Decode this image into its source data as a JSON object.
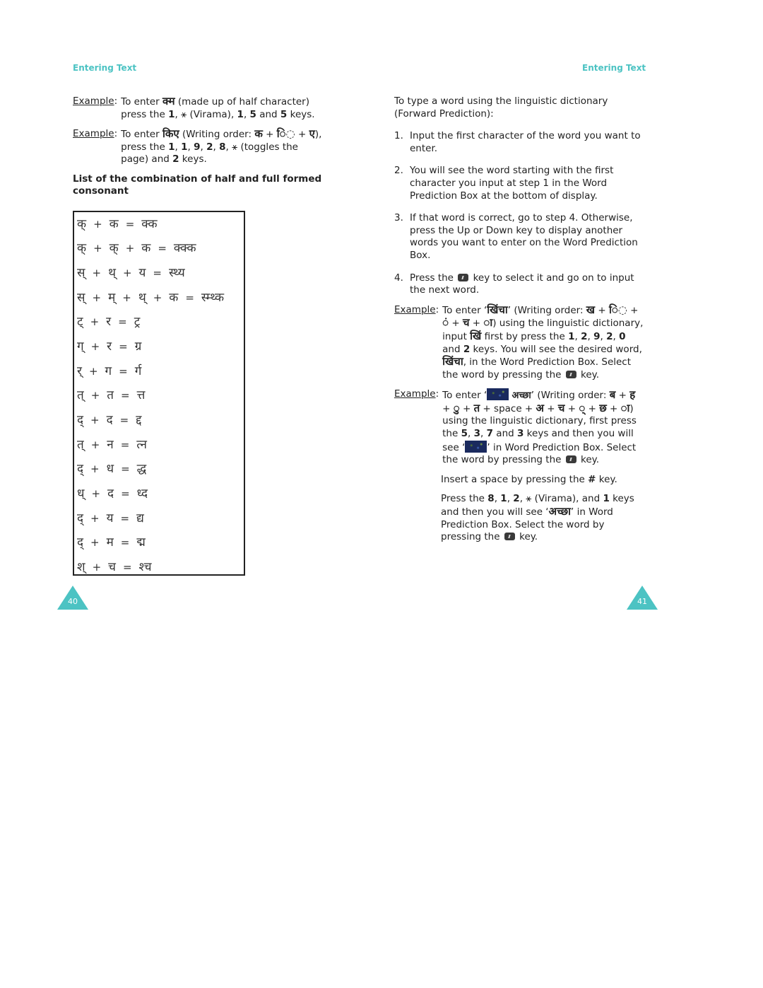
{
  "running_head": {
    "left": "Entering Text",
    "right": "Entering Text"
  },
  "left_page": {
    "example1": {
      "label": "Example",
      "t1": "To enter ",
      "word": "क्म",
      "t2": " (made up of half character) press the ",
      "k1": "1",
      "t3": ", ",
      "star": "⚹",
      "t4": " (Virama), ",
      "k2": "1",
      "t5": ",  ",
      "k3": "5",
      "t6": " and ",
      "k4": "5",
      "t7": " keys."
    },
    "example2": {
      "label": "Example",
      "t1": "To enter ",
      "word": "किए",
      "t2": " (Writing order: ",
      "w1": "क",
      "t3": " + ",
      "w2": "ि◌",
      "t4": " + ",
      "w3": "ए",
      "t5": "), press the ",
      "k1": "1",
      "c1": ", ",
      "k2": "1",
      "c2": ", ",
      "k3": "9",
      "c3": ", ",
      "k4": "2",
      "c4": ", ",
      "k5": "8",
      "c5": ", ",
      "star": "⚹",
      "t6": " (toggles the page) and ",
      "k6": "2",
      "t7": " keys."
    },
    "list_heading": "List of the combination of half and full formed consonant",
    "combinations": [
      {
        "parts": [
          "क्",
          "क"
        ],
        "result": "क्क"
      },
      {
        "parts": [
          "क्",
          "क्",
          "क"
        ],
        "result": "क्क्क"
      },
      {
        "parts": [
          "स्",
          "थ्",
          "य"
        ],
        "result": "स्थ्य"
      },
      {
        "parts": [
          "स्",
          "म्",
          "थ्",
          "क"
        ],
        "result": "स्म्थ्क"
      },
      {
        "parts": [
          "ट्",
          "र"
        ],
        "result": "ट्र"
      },
      {
        "parts": [
          "ग्",
          "र"
        ],
        "result": "ग्र"
      },
      {
        "parts": [
          "र्",
          "ग"
        ],
        "result": "र्ग"
      },
      {
        "parts": [
          "त्",
          "त"
        ],
        "result": "त्त"
      },
      {
        "parts": [
          "द्",
          "द"
        ],
        "result": "द्द"
      },
      {
        "parts": [
          "त्",
          "न"
        ],
        "result": "त्न"
      },
      {
        "parts": [
          "द्",
          "ध"
        ],
        "result": "द्ध"
      },
      {
        "parts": [
          "ध्",
          "द"
        ],
        "result": "ध्द"
      },
      {
        "parts": [
          "द्",
          "य"
        ],
        "result": "द्य"
      },
      {
        "parts": [
          "द्",
          "म"
        ],
        "result": "द्म"
      },
      {
        "parts": [
          "श्",
          "च"
        ],
        "result": "श्च"
      }
    ],
    "plus": "+",
    "equals": "=",
    "page_number": "40"
  },
  "right_page": {
    "intro": "To type a word using the linguistic dictionary (Forward Prediction):",
    "steps": [
      {
        "num": "1.",
        "text": "Input the first character of the word you want to enter."
      },
      {
        "num": "2.",
        "text": "You will see the word starting with the first character you input at step 1 in the Word Prediction Box at the bottom of display."
      },
      {
        "num": "3.",
        "text": "If that word is correct, go to step 4. Otherwise, press the Up or Down key to display another words you want to enter on the Word Prediction Box."
      },
      {
        "num": "4.",
        "text_a": "Press the ",
        "icon": "select-key-icon",
        "text_b": " key to select it and go on to input the next word."
      }
    ],
    "example3": {
      "label": "Example",
      "t1": "To enter ‘",
      "word": "खिंचा",
      "t2": "’ (Writing order: ",
      "w1": "ख",
      "t3": " + ",
      "w2": "ि◌",
      "t4": " + ",
      "w3": "◌ं",
      "t5": " + ",
      "w4": "च",
      "t6": " + ",
      "w5": "◌ा",
      "t7": ") using the linguistic dictionary, input ",
      "w6": "खिं",
      "t8": " first by press the ",
      "k1": "1",
      "c1": ", ",
      "k2": "2",
      "c2": ", ",
      "k3": "9",
      "c3": ", ",
      "k4": "2",
      "c4": ", ",
      "k5": "0",
      "t9": " and ",
      "k6": "2",
      "t10": " keys. You will see the desired word, ",
      "w7": "खिंचा",
      "t11": ", in the Word Prediction Box. Select the word by pressing the ",
      "t12": " key."
    },
    "example4": {
      "label": "Example",
      "t1": "To enter ‘",
      "word": "अच्छा",
      "t2": "’ (Writing order: ",
      "w1": "ब",
      "t3": " + ",
      "w2": "ह",
      "t4": " + ",
      "w3": "◌ु",
      "t5": " + ",
      "w4": "त",
      "t6": " + space + ",
      "w5": "अ",
      "t7": " + ",
      "w6": "च",
      "t8": " + ",
      "w7": "◌्",
      "t9": " + ",
      "w8": "छ",
      "t10": " + ",
      "w9": "◌ा",
      "t11": ") using the linguistic dictionary, first press the ",
      "k1": "5",
      "c1": ", ",
      "k2": "3",
      "c2": ", ",
      "k3": "7",
      "t12": " and ",
      "k4": "3",
      "t13": " keys and then you will see ‘",
      "t14": "’ in Word Prediction Box. Select the word by pressing the ",
      "t15": " key."
    },
    "space_note": {
      "t1": "Insert a space by pressing the ",
      "key": "#",
      "t2": " key."
    },
    "final_note": {
      "t1": "Press the ",
      "k1": "8",
      "c1": ", ",
      "k2": "1",
      "c2": ", ",
      "k3": "2",
      "c3": ", ",
      "star": "⚹",
      "t2": " (Virama), and ",
      "k4": "1",
      "t3": " keys and then you will see ‘",
      "word": "अच्छा",
      "t4": "’ in Word Prediction Box. Select the word by pressing the ",
      "t5": " key."
    },
    "page_number": "41"
  },
  "colors": {
    "accent": "#4cc3c3",
    "text": "#222222"
  }
}
